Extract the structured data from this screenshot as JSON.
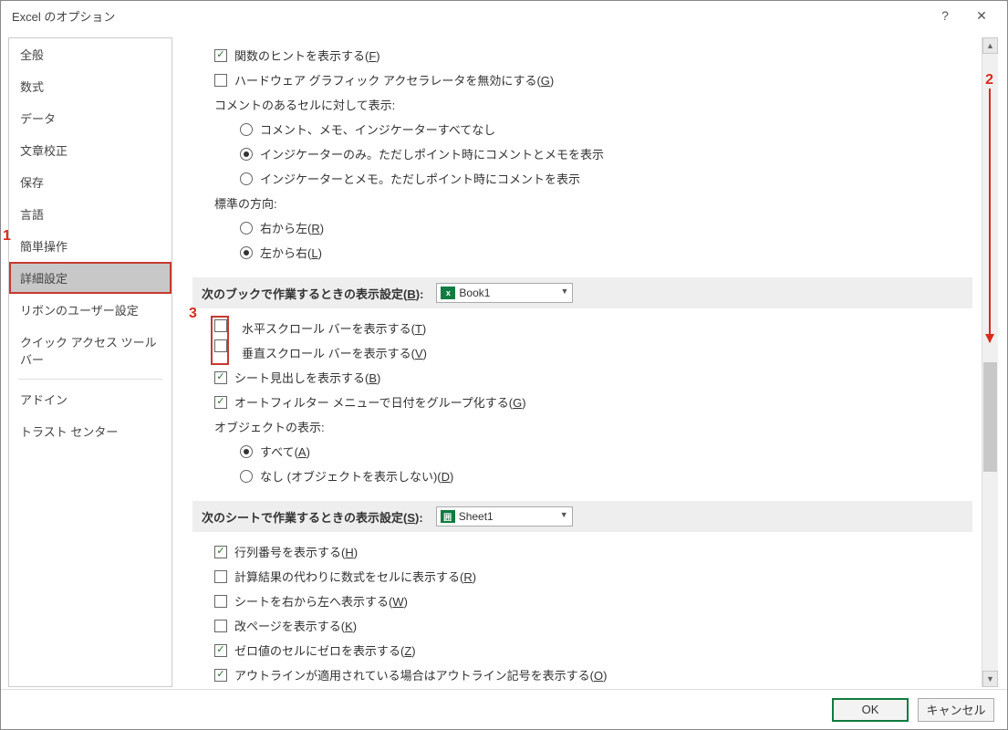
{
  "window": {
    "title": "Excel のオプション",
    "help": "?",
    "close": "✕"
  },
  "sidebar": {
    "items": [
      "全般",
      "数式",
      "データ",
      "文章校正",
      "保存",
      "言語",
      "簡単操作",
      "詳細設定",
      "リボンのユーザー設定",
      "クイック アクセス ツール バー",
      "アドイン",
      "トラスト センター"
    ],
    "selected_index": 7
  },
  "top_section": {
    "function_tips": "関数のヒントを表示する(",
    "function_tips_key": "F",
    "function_tips_tail": ")",
    "hw_accel": "ハードウェア グラフィック アクセラレータを無効にする(",
    "hw_accel_key": "G",
    "hw_accel_tail": ")",
    "comments_heading": "コメントのあるセルに対して表示:",
    "comments_opt1": "コメント、メモ、インジケーターすべてなし",
    "comments_opt2": "インジケーターのみ。ただしポイント時にコメントとメモを表示",
    "comments_opt3": "インジケーターとメモ。ただしポイント時にコメントを表示",
    "dir_heading": "標準の方向:",
    "dir_rtl": "右から左(",
    "dir_rtl_key": "R",
    "dir_rtl_tail": ")",
    "dir_ltr": "左から右(",
    "dir_ltr_key": "L",
    "dir_ltr_tail": ")"
  },
  "book_section": {
    "heading": "次のブックで作業するときの表示設定(",
    "heading_key": "B",
    "heading_tail": "):",
    "combo_label": "Book1",
    "h_scroll": "水平スクロール バーを表示する(",
    "h_scroll_key": "T",
    "h_scroll_tail": ")",
    "v_scroll": "垂直スクロール バーを表示する(",
    "v_scroll_key": "V",
    "v_scroll_tail": ")",
    "sheet_tabs": "シート見出しを表示する(",
    "sheet_tabs_key": "B",
    "sheet_tabs_tail": ")",
    "autofilter_group": "オートフィルター メニューで日付をグループ化する(",
    "autofilter_group_key": "G",
    "autofilter_group_tail": ")",
    "objects_heading": "オブジェクトの表示:",
    "objects_all": "すべて(",
    "objects_all_key": "A",
    "objects_all_tail": ")",
    "objects_none": "なし (オブジェクトを表示しない)(",
    "objects_none_key": "D",
    "objects_none_tail": ")"
  },
  "sheet_section": {
    "heading": "次のシートで作業するときの表示設定(",
    "heading_key": "S",
    "heading_tail": "):",
    "combo_label": "Sheet1",
    "rowcol": "行列番号を表示する(",
    "rowcol_key": "H",
    "rowcol_tail": ")",
    "formulas": "計算結果の代わりに数式をセルに表示する(",
    "formulas_key": "R",
    "formulas_tail": ")",
    "rtl_sheet": "シートを右から左へ表示する(",
    "rtl_sheet_key": "W",
    "rtl_sheet_tail": ")",
    "page_breaks": "改ページを表示する(",
    "page_breaks_key": "K",
    "page_breaks_tail": ")",
    "zeros": "ゼロ値のセルにゼロを表示する(",
    "zeros_key": "Z",
    "zeros_tail": ")",
    "outline": "アウトラインが適用されている場合はアウトライン記号を表示する(",
    "outline_key": "O",
    "outline_tail": ")"
  },
  "footer": {
    "ok": "OK",
    "cancel": "キャンセル"
  },
  "annotations": {
    "one": "1",
    "two": "2",
    "three": "3"
  }
}
